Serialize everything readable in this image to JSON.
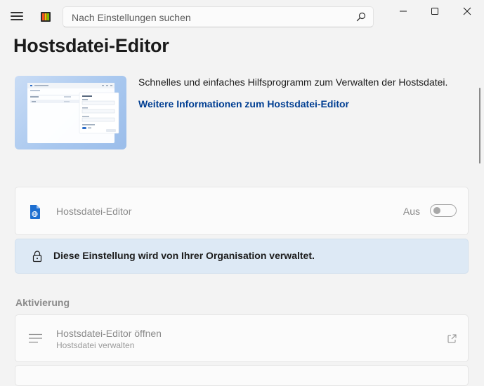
{
  "search": {
    "placeholder": "Nach Einstellungen suchen"
  },
  "icons": {
    "menu": "hamburger-icon",
    "app": "powertoys-icon",
    "search": "search-icon",
    "minimize": "minimize-icon",
    "maximize": "maximize-icon",
    "close": "close-icon",
    "module": "hosts-file-icon",
    "lock": "lock-icon",
    "launch": "list-icon",
    "external": "open-external-icon"
  },
  "page": {
    "title": "Hostsdatei-Editor"
  },
  "hero": {
    "description": "Schnelles und einfaches Hilfsprogramm zum Verwalten der Hostsdatei.",
    "link": "Weitere Informationen zum Hostsdatei-Editor"
  },
  "toggle_card": {
    "label": "Hostsdatei-Editor",
    "state": "Aus",
    "enabled": false
  },
  "info_bar": {
    "message": "Diese Einstellung wird von Ihrer Organisation verwaltet."
  },
  "activation": {
    "header": "Aktivierung",
    "launch": {
      "title": "Hostsdatei-Editor öffnen",
      "subtitle": "Hostsdatei verwalten"
    }
  },
  "colors": {
    "accent_link": "#003e92",
    "info_bar_bg": "#dde9f5",
    "disabled_text": "#8b8b8b"
  }
}
